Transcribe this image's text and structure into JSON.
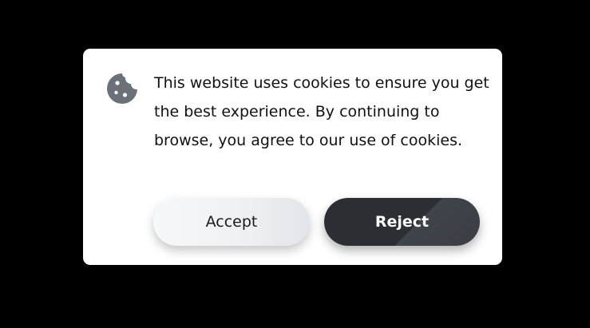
{
  "cookie_banner": {
    "icon": "cookie-icon",
    "message": "This website uses cookies to ensure you get the best experience. By continuing to browse, you agree to our use of cookies.",
    "accept_label": "Accept",
    "reject_label": "Reject"
  },
  "colors": {
    "backdrop": "#000000",
    "card": "#ffffff",
    "icon": "#6b7079",
    "text": "#111111",
    "accept_bg": "#f0f2f4",
    "reject_bg": "#2b2e33",
    "reject_text": "#ffffff"
  }
}
